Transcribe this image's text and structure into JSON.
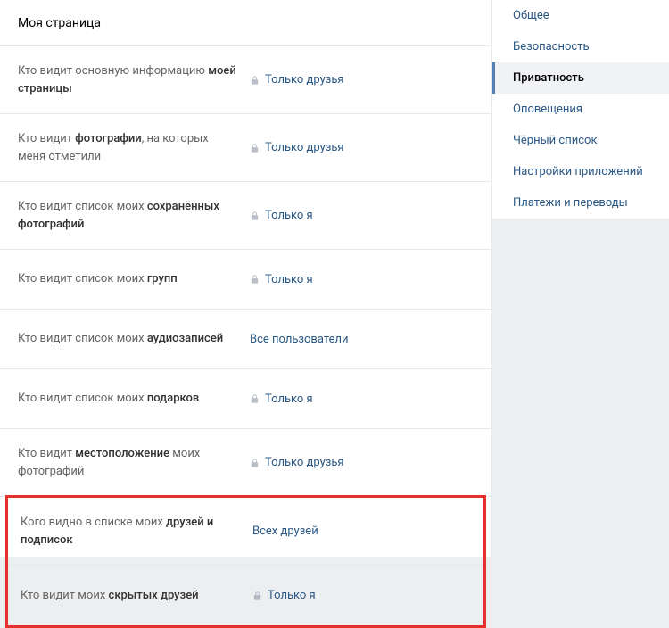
{
  "section_title": "Моя страница",
  "settings": [
    {
      "label_prefix": "Кто видит основную информацию ",
      "label_bold": "моей страницы",
      "label_suffix": "",
      "value": "Только друзья",
      "locked": true
    },
    {
      "label_prefix": "Кто видит ",
      "label_bold": "фотографии",
      "label_suffix": ", на которых меня отметили",
      "value": "Только друзья",
      "locked": true
    },
    {
      "label_prefix": "Кто видит список моих ",
      "label_bold": "сохранённых фотографий",
      "label_suffix": "",
      "value": "Только я",
      "locked": true
    },
    {
      "label_prefix": "Кто видит список моих ",
      "label_bold": "групп",
      "label_suffix": "",
      "value": "Только я",
      "locked": true
    },
    {
      "label_prefix": "Кто видит список моих ",
      "label_bold": "аудиозаписей",
      "label_suffix": "",
      "value": "Все пользователи",
      "locked": false
    },
    {
      "label_prefix": "Кто видит список моих ",
      "label_bold": "подарков",
      "label_suffix": "",
      "value": "Только я",
      "locked": true
    },
    {
      "label_prefix": "Кто видит ",
      "label_bold": "местоположение",
      "label_suffix": " моих фотографий",
      "value": "Только друзья",
      "locked": true
    },
    {
      "label_prefix": "Кого видно в списке моих ",
      "label_bold": "друзей и подписок",
      "label_suffix": "",
      "value": "Всех друзей",
      "locked": false
    },
    {
      "label_prefix": "Кто видит моих ",
      "label_bold": "скрытых друзей",
      "label_suffix": "",
      "value": "Только я",
      "locked": true
    }
  ],
  "sidebar": {
    "items": [
      {
        "label": "Общее",
        "active": false
      },
      {
        "label": "Безопасность",
        "active": false
      },
      {
        "label": "Приватность",
        "active": true
      },
      {
        "label": "Оповещения",
        "active": false
      },
      {
        "label": "Чёрный список",
        "active": false
      },
      {
        "label": "Настройки приложений",
        "active": false
      },
      {
        "label": "Платежи и переводы",
        "active": false
      }
    ]
  }
}
